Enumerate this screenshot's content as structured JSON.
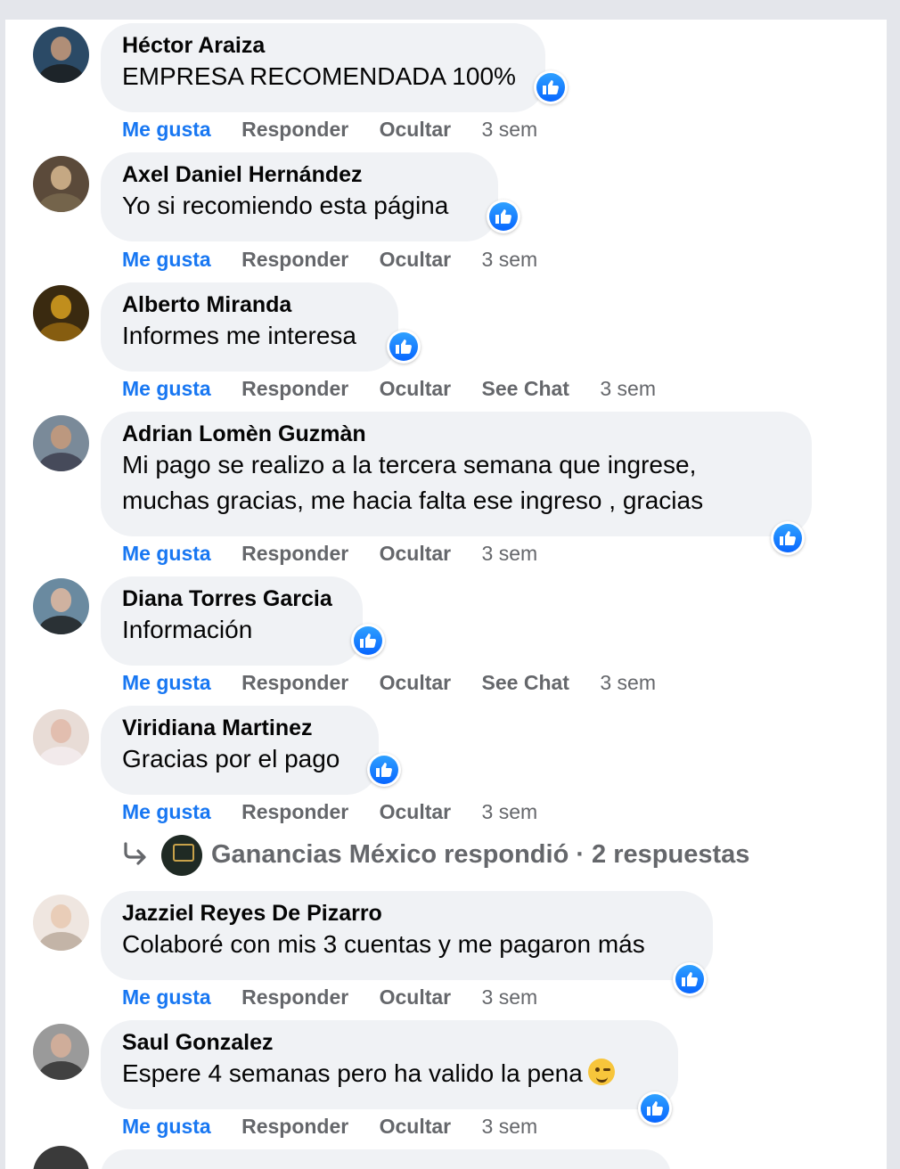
{
  "actions": {
    "like": "Me gusta",
    "reply": "Responder",
    "hide": "Ocultar",
    "see_chat": "See Chat"
  },
  "comments": [
    {
      "name": "Héctor Araiza",
      "text": "EMPRESA RECOMENDADA 100%",
      "time": "3 sem",
      "avatar_color": "#2b4a66"
    },
    {
      "name": "Axel Daniel Hernández",
      "text": "Yo si recomiendo esta página",
      "time": "3 sem",
      "avatar_color": "#5b4a3a"
    },
    {
      "name": "Alberto Miranda",
      "text": "Informes me interesa",
      "time": "3 sem",
      "avatar_color": "#3a2a10"
    },
    {
      "name": "Adrian Lomèn Guzmàn",
      "text_line1": "Mi pago se realizo a la tercera semana que ingrese,",
      "text_line2": "muchas gracias, me hacia falta ese ingreso , gracias",
      "time": "3 sem",
      "avatar_color": "#7a8a99"
    },
    {
      "name": "Diana Torres Garcia",
      "text": "Información",
      "time": "3 sem",
      "avatar_color": "#6a8aa0"
    },
    {
      "name": "Viridiana Martinez",
      "text": "Gracias por el pago",
      "time": "3 sem",
      "avatar_color": "#d8c8c0"
    },
    {
      "name": "Jazziel Reyes De Pizarro",
      "text": "Colaboré con mis 3 cuentas y me pagaron más",
      "time": "3 sem",
      "avatar_color": "#c8b8a8"
    },
    {
      "name": "Saul Gonzalez",
      "text": "Espere 4 semanas pero ha valido la pena",
      "time": "3 sem",
      "avatar_color": "#8a8a8a",
      "emoji": "winking-face"
    }
  ],
  "reply_summary": "Ganancias México respondió · 2 respuestas",
  "colors": {
    "like_blue": "#1877f2",
    "bubble": "#f0f2f5",
    "meta_gray": "#65676b",
    "page_bg": "#e4e6eb"
  }
}
